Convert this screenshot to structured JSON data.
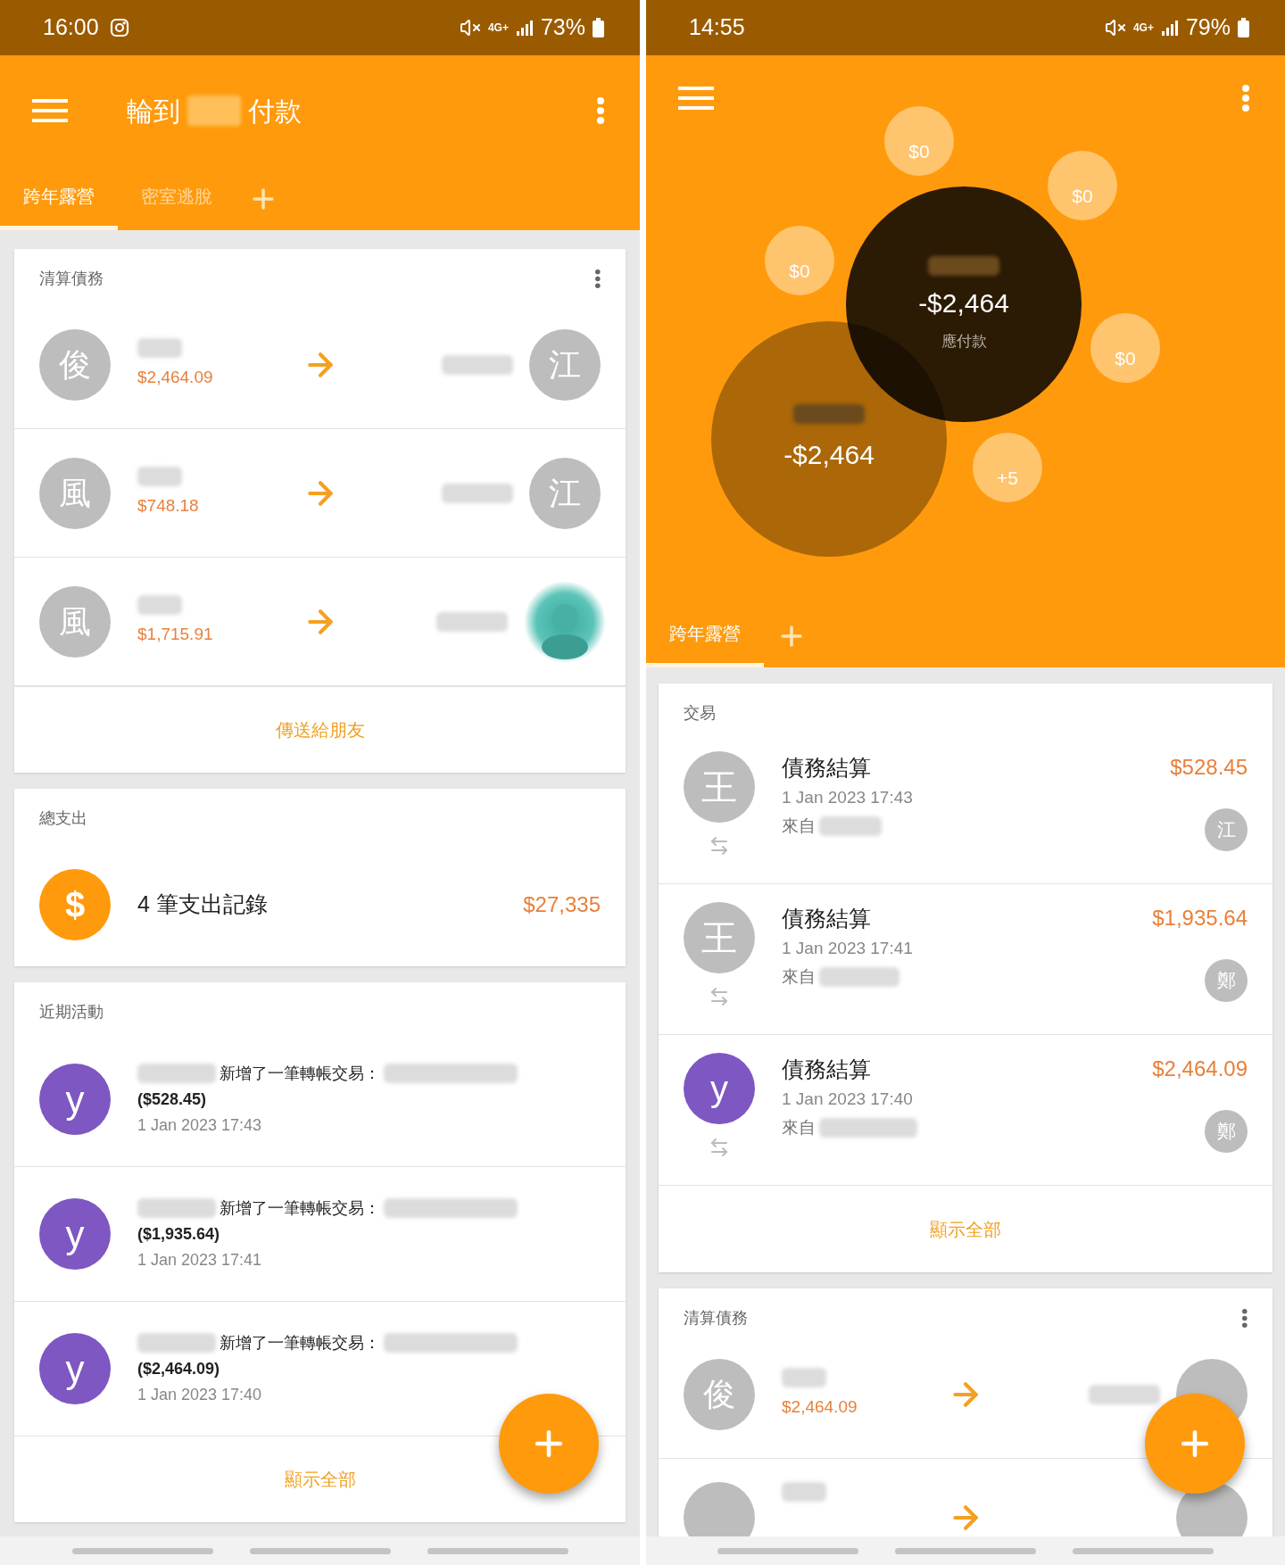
{
  "left_screen": {
    "status_bar": {
      "time": "16:00",
      "network": "4G+",
      "battery": "73%"
    },
    "app_bar": {
      "title_start": "輪到",
      "title_end": "付款"
    },
    "tabs": [
      {
        "label": "跨年露營",
        "selected": true
      },
      {
        "label": "密室逃脫",
        "selected": false
      }
    ],
    "settle_card": {
      "title": "清算債務",
      "rows": [
        {
          "from_initial": "俊",
          "amount": "$2,464.09",
          "to": {
            "kind": "letter",
            "initial": "江"
          }
        },
        {
          "from_initial": "風",
          "amount": "$748.18",
          "to": {
            "kind": "letter",
            "initial": "江"
          }
        },
        {
          "from_initial": "風",
          "amount": "$1,715.91"
        }
      ],
      "action": "傳送給朋友"
    },
    "spending_card": {
      "title": "總支出",
      "symbol": "$",
      "summary": "4 筆支出記錄",
      "total": "$27,335"
    },
    "activity_card": {
      "title": "近期活動",
      "items": [
        {
          "initial": "y",
          "color": "#7e57c2",
          "action": "新增了一筆轉帳交易：",
          "amount": "($528.45)",
          "time": "1 Jan 2023 17:43"
        },
        {
          "initial": "y",
          "color": "#7e57c2",
          "action": "新增了一筆轉帳交易：",
          "amount": "($1,935.64)",
          "time": "1 Jan 2023 17:41"
        },
        {
          "initial": "y",
          "color": "#7e57c2",
          "action": "新增了一筆轉帳交易：",
          "amount": "($2,464.09)",
          "time": "1 Jan 2023 17:40"
        }
      ],
      "show_all": "顯示全部"
    }
  },
  "right_screen": {
    "status_bar": {
      "time": "14:55",
      "network": "4G+",
      "battery": "79%"
    },
    "bubbles": [
      {
        "kind": "small",
        "label": "$0"
      },
      {
        "kind": "small",
        "label": "$0"
      },
      {
        "kind": "small",
        "label": "$0"
      },
      {
        "kind": "small",
        "label": "$0"
      },
      {
        "kind": "small",
        "label": "+5"
      },
      {
        "kind": "large",
        "amount": "-$2,464"
      },
      {
        "kind": "main",
        "amount": "-$2,464",
        "caption": "應付款"
      }
    ],
    "tabs": [
      {
        "label": "跨年露營",
        "selected": true
      }
    ],
    "transactions_card": {
      "title": "交易",
      "items": [
        {
          "initial": "王",
          "color": "#bdbdbd",
          "title": "債務結算",
          "time": "1 Jan 2023 17:43",
          "from_label": "來自",
          "amount": "$528.45",
          "to_initial": "江"
        },
        {
          "initial": "王",
          "color": "#bdbdbd",
          "title": "債務結算",
          "time": "1 Jan 2023 17:41",
          "from_label": "來自",
          "amount": "$1,935.64",
          "to_initial": "鄭"
        },
        {
          "initial": "y",
          "color": "#7e57c2",
          "title": "債務結算",
          "time": "1 Jan 2023 17:40",
          "from_label": "來自",
          "amount": "$2,464.09",
          "to_initial": "鄭"
        }
      ],
      "show_all": "顯示全部"
    },
    "settle_card": {
      "title": "清算債務",
      "rows": [
        {
          "kind": "full",
          "from_initial": "俊",
          "amount": "$2,464.09"
        },
        {
          "kind": "clipped"
        }
      ]
    }
  }
}
